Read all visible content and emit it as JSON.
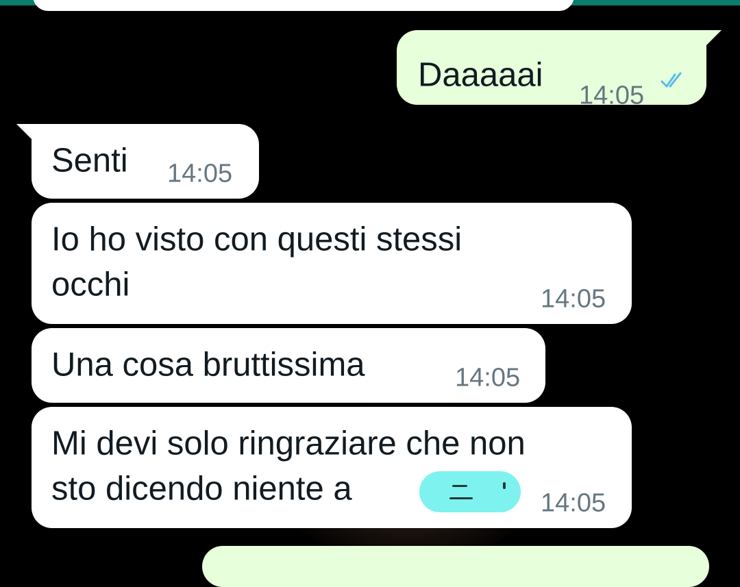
{
  "chat": {
    "messages": [
      {
        "direction": "outgoing",
        "text": "Daaaaai",
        "time": "14:05",
        "status": "read"
      },
      {
        "direction": "incoming",
        "text": "Senti",
        "time": "14:05"
      },
      {
        "direction": "incoming",
        "text_lines": [
          "Io ho visto con questi stessi",
          "occhi"
        ],
        "time": "14:05"
      },
      {
        "direction": "incoming",
        "text": "Una cosa bruttissima",
        "time": "14:05"
      },
      {
        "direction": "incoming",
        "text_lines": [
          "Mi devi solo ringraziare che non",
          "sto dicendo niente a"
        ],
        "time": "14:05",
        "redacted": true
      }
    ]
  },
  "theme": {
    "header_color": "#0b7d6b",
    "outgoing_bubble": "#e7ffdb",
    "incoming_bubble": "#ffffff",
    "read_tick_color": "#53bdeb",
    "redaction_color": "#7ef2ee"
  },
  "icons": {
    "read_receipt": "double-check-icon"
  }
}
